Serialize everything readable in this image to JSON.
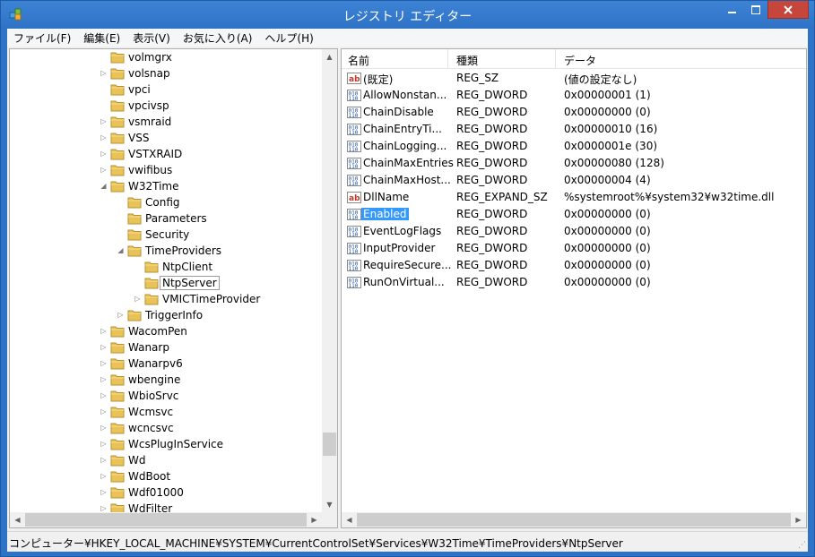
{
  "window": {
    "title": "レジストリ エディター"
  },
  "menu": [
    "ファイル(F)",
    "編集(E)",
    "表示(V)",
    "お気に入り(A)",
    "ヘルプ(H)"
  ],
  "tree": [
    {
      "label": "volmgrx",
      "depth": 6,
      "expander": "none"
    },
    {
      "label": "volsnap",
      "depth": 6,
      "expander": "collapsed"
    },
    {
      "label": "vpci",
      "depth": 6,
      "expander": "none"
    },
    {
      "label": "vpcivsp",
      "depth": 6,
      "expander": "none"
    },
    {
      "label": "vsmraid",
      "depth": 6,
      "expander": "collapsed"
    },
    {
      "label": "VSS",
      "depth": 6,
      "expander": "collapsed"
    },
    {
      "label": "VSTXRAID",
      "depth": 6,
      "expander": "collapsed"
    },
    {
      "label": "vwifibus",
      "depth": 6,
      "expander": "collapsed"
    },
    {
      "label": "W32Time",
      "depth": 6,
      "expander": "expanded"
    },
    {
      "label": "Config",
      "depth": 7,
      "expander": "none"
    },
    {
      "label": "Parameters",
      "depth": 7,
      "expander": "none"
    },
    {
      "label": "Security",
      "depth": 7,
      "expander": "none"
    },
    {
      "label": "TimeProviders",
      "depth": 7,
      "expander": "expanded"
    },
    {
      "label": "NtpClient",
      "depth": 8,
      "expander": "none"
    },
    {
      "label": "NtpServer",
      "depth": 8,
      "expander": "none",
      "selected": true
    },
    {
      "label": "VMICTimeProvider",
      "depth": 8,
      "expander": "collapsed"
    },
    {
      "label": "TriggerInfo",
      "depth": 7,
      "expander": "collapsed"
    },
    {
      "label": "WacomPen",
      "depth": 6,
      "expander": "collapsed"
    },
    {
      "label": "Wanarp",
      "depth": 6,
      "expander": "collapsed"
    },
    {
      "label": "Wanarpv6",
      "depth": 6,
      "expander": "collapsed"
    },
    {
      "label": "wbengine",
      "depth": 6,
      "expander": "collapsed"
    },
    {
      "label": "WbioSrvc",
      "depth": 6,
      "expander": "collapsed"
    },
    {
      "label": "Wcmsvc",
      "depth": 6,
      "expander": "collapsed"
    },
    {
      "label": "wcncsvc",
      "depth": 6,
      "expander": "collapsed"
    },
    {
      "label": "WcsPlugInService",
      "depth": 6,
      "expander": "collapsed"
    },
    {
      "label": "Wd",
      "depth": 6,
      "expander": "collapsed"
    },
    {
      "label": "WdBoot",
      "depth": 6,
      "expander": "collapsed"
    },
    {
      "label": "Wdf01000",
      "depth": 6,
      "expander": "collapsed"
    },
    {
      "label": "WdFilter",
      "depth": 6,
      "expander": "collapsed"
    }
  ],
  "columns": [
    "名前",
    "種類",
    "データ"
  ],
  "values": [
    {
      "icon": "string-value-icon",
      "name": "(既定)",
      "type": "REG_SZ",
      "data": "(値の設定なし)"
    },
    {
      "icon": "binary-value-icon",
      "name": "AllowNonstan...",
      "type": "REG_DWORD",
      "data": "0x00000001 (1)"
    },
    {
      "icon": "binary-value-icon",
      "name": "ChainDisable",
      "type": "REG_DWORD",
      "data": "0x00000000 (0)"
    },
    {
      "icon": "binary-value-icon",
      "name": "ChainEntryTi...",
      "type": "REG_DWORD",
      "data": "0x00000010 (16)"
    },
    {
      "icon": "binary-value-icon",
      "name": "ChainLogging...",
      "type": "REG_DWORD",
      "data": "0x0000001e (30)"
    },
    {
      "icon": "binary-value-icon",
      "name": "ChainMaxEntries",
      "type": "REG_DWORD",
      "data": "0x00000080 (128)"
    },
    {
      "icon": "binary-value-icon",
      "name": "ChainMaxHost...",
      "type": "REG_DWORD",
      "data": "0x00000004 (4)"
    },
    {
      "icon": "string-value-icon",
      "name": "DllName",
      "type": "REG_EXPAND_SZ",
      "data": "%systemroot%¥system32¥w32time.dll"
    },
    {
      "icon": "binary-value-icon",
      "name": "Enabled",
      "type": "REG_DWORD",
      "data": "0x00000000 (0)",
      "selected": true
    },
    {
      "icon": "binary-value-icon",
      "name": "EventLogFlags",
      "type": "REG_DWORD",
      "data": "0x00000000 (0)"
    },
    {
      "icon": "binary-value-icon",
      "name": "InputProvider",
      "type": "REG_DWORD",
      "data": "0x00000000 (0)"
    },
    {
      "icon": "binary-value-icon",
      "name": "RequireSecure...",
      "type": "REG_DWORD",
      "data": "0x00000000 (0)"
    },
    {
      "icon": "binary-value-icon",
      "name": "RunOnVirtual...",
      "type": "REG_DWORD",
      "data": "0x00000000 (0)"
    }
  ],
  "status": "コンピューター¥HKEY_LOCAL_MACHINE¥SYSTEM¥CurrentControlSet¥Services¥W32Time¥TimeProviders¥NtpServer",
  "colors": {
    "titlebar": "#2f73c7",
    "selection": "#3399ff",
    "close": "#c7463b",
    "folder": "#e8c35a"
  }
}
